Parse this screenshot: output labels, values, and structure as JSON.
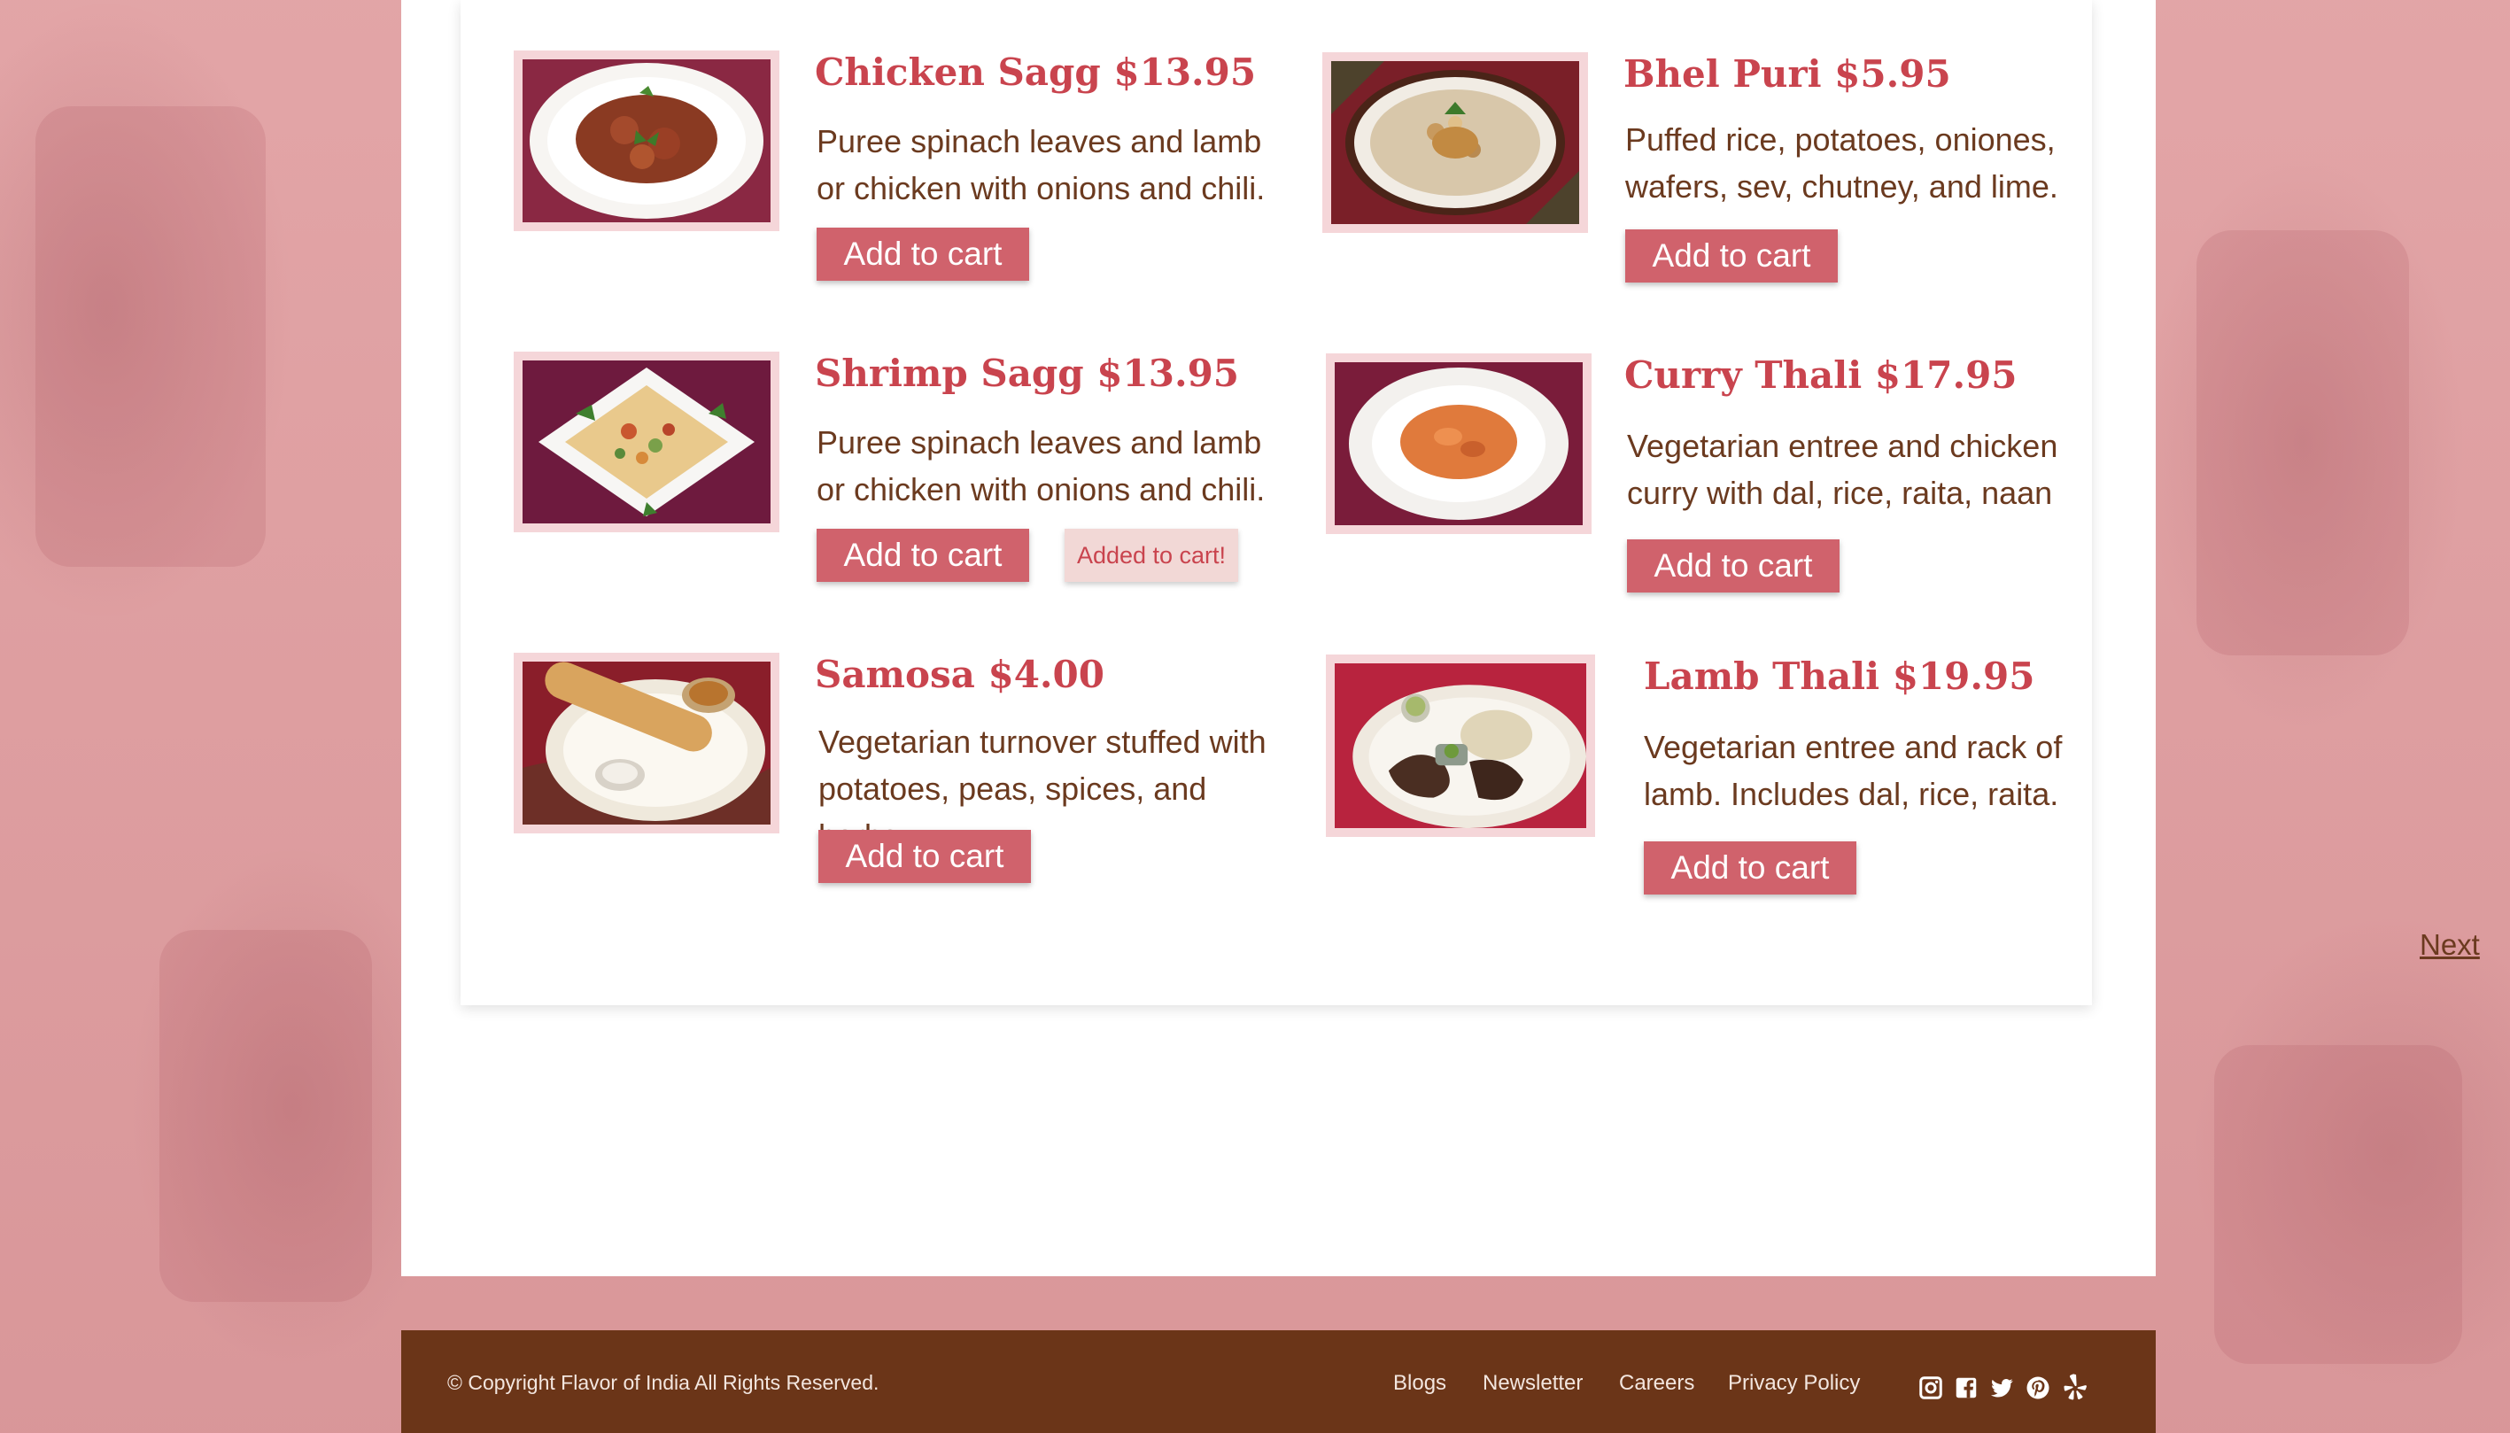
{
  "menu": {
    "items": [
      {
        "title": "Chicken Sagg $13.95",
        "description": "Puree spinach leaves and lamb or chicken with onions and chili.",
        "button": "Add to cart",
        "photo": "curry-bowl-photo"
      },
      {
        "title": "Bhel Puri $5.95",
        "description": "Puffed rice, potatoes, oniones, wafers, sev, chutney, and lime.",
        "button": "Add to cart",
        "photo": "bhel-puri-plate-photo"
      },
      {
        "title": "Shrimp Sagg $13.95",
        "description": "Puree spinach leaves and lamb or chicken with onions and chili.",
        "button": "Add to cart",
        "added_label": "Added to cart!",
        "photo": "chaat-plate-photo"
      },
      {
        "title": "Curry Thali $17.95",
        "description": "Vegetarian entree and chicken curry with dal, rice, raita, naan",
        "button": "Add to cart",
        "photo": "orange-curry-photo"
      },
      {
        "title": "Samosa $4.00",
        "description": "Vegetarian turnover stuffed with potatoes, peas, spices, and herbs.",
        "button": "Add to cart",
        "photo": "dosa-plate-photo"
      },
      {
        "title": "Lamb Thali $19.95",
        "description": "Vegetarian entree and rack of lamb. Includes dal, rice, raita.",
        "button": "Add to cart",
        "photo": "lamb-thali-photo"
      }
    ],
    "next_label": "Next"
  },
  "footer": {
    "copyright": "© Copyright Flavor of India All Rights Reserved.",
    "links": [
      "Blogs",
      "Newsletter",
      "Careers",
      "Privacy Policy"
    ],
    "social_icons": [
      "instagram-icon",
      "facebook-icon",
      "twitter-icon",
      "pinterest-icon",
      "yelp-icon"
    ]
  },
  "colors": {
    "accent": "#c9444e",
    "button": "#d0626c",
    "text": "#6b3a1f",
    "footer": "#6b3518",
    "page_background": "#e1a0a2",
    "thumb_frame": "#f5d6d9"
  }
}
